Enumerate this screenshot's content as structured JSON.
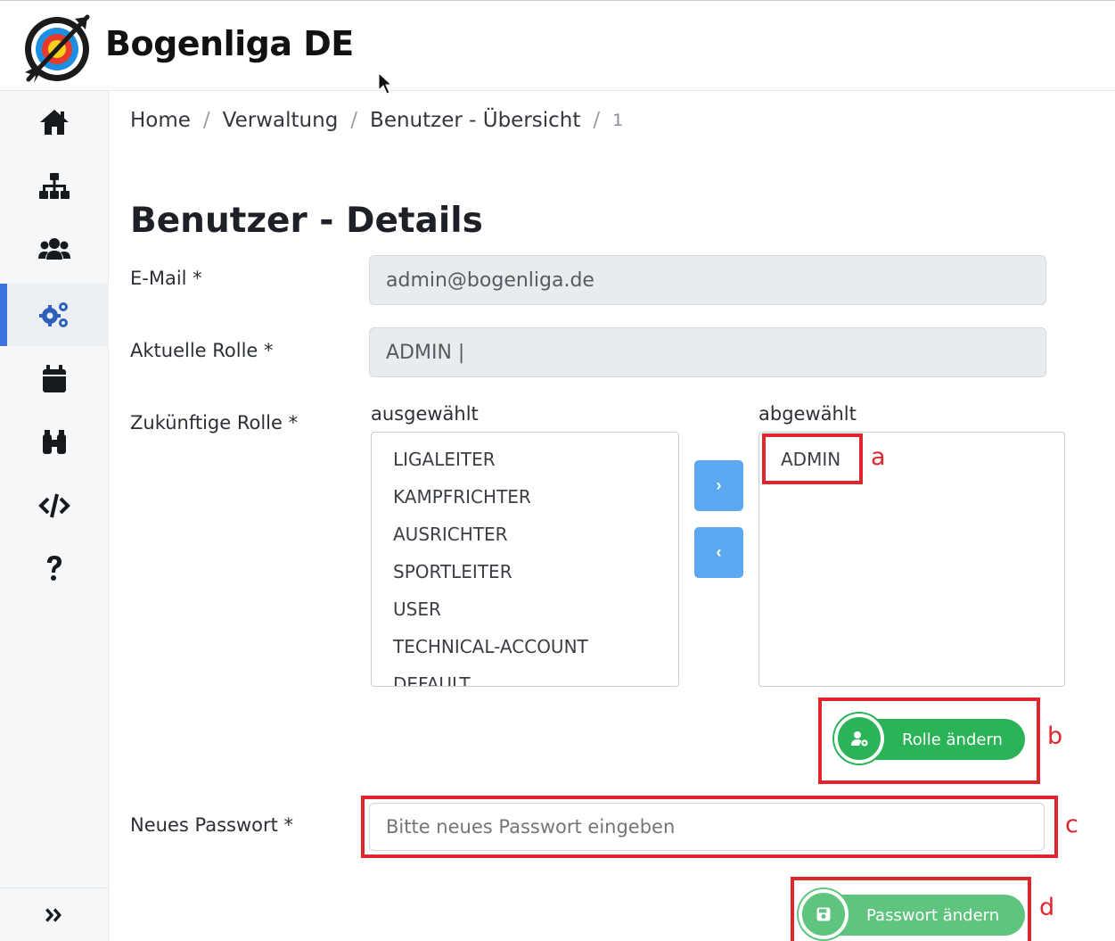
{
  "app": {
    "title": "Bogenliga DE"
  },
  "sidebar": {
    "items": [
      {
        "icon": "home-icon"
      },
      {
        "icon": "sitemap-icon"
      },
      {
        "icon": "users-icon"
      },
      {
        "icon": "cogs-icon",
        "active": true
      },
      {
        "icon": "calendar-icon"
      },
      {
        "icon": "binoculars-icon"
      },
      {
        "icon": "code-icon"
      },
      {
        "icon": "question-icon"
      }
    ],
    "expand": {
      "label": "»",
      "icon": "double-chevron-right-icon"
    }
  },
  "breadcrumb": {
    "home": "Home",
    "verwaltung": "Verwaltung",
    "uebersicht": "Benutzer - Übersicht",
    "current": "1",
    "separator": "/"
  },
  "page": {
    "title": "Benutzer - Details"
  },
  "form": {
    "email": {
      "label": "E-Mail *",
      "value": "admin@bogenliga.de"
    },
    "current_role": {
      "label": "Aktuelle Rolle *",
      "value": "ADMIN |"
    },
    "future_role": {
      "label": "Zukünftige Rolle *",
      "selected_heading": "ausgewählt",
      "deselected_heading": "abgewählt",
      "selected_options": [
        "LIGALEITER",
        "KAMPFRICHTER",
        "AUSRICHTER",
        "SPORTLEITER",
        "USER",
        "TECHNICAL-ACCOUNT",
        "DEFAULT"
      ],
      "deselected_options": [
        "ADMIN"
      ],
      "move_right_label": "›",
      "move_left_label": "‹"
    },
    "change_role_button": {
      "label": "Rolle ändern",
      "icon": "user-cog-icon"
    },
    "new_password": {
      "label": "Neues Passwort *",
      "placeholder": "Bitte neues Passwort eingeben"
    },
    "change_password_button": {
      "label": "Passwort ändern",
      "icon": "save-icon"
    }
  },
  "annotations": {
    "a": "a",
    "b": "b",
    "c": "c",
    "d": "d",
    "color": "#e0262c"
  },
  "colors": {
    "accent": "#3b73dc",
    "success": "#2bb358",
    "move_button": "#5ba8f0"
  }
}
